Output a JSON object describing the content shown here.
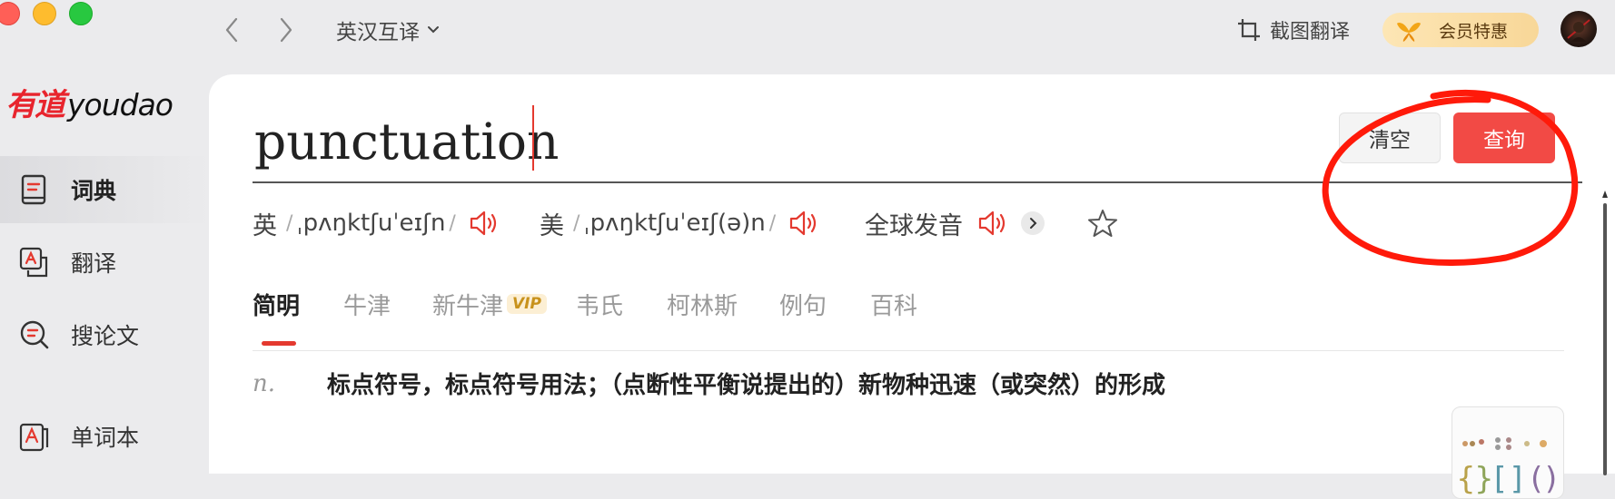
{
  "window": {
    "traffic_lights": [
      "close",
      "minimize",
      "zoom"
    ]
  },
  "topbar": {
    "mode_label": "英汉互译",
    "screenshot_label": "截图翻译",
    "vip_label": "会员特惠"
  },
  "sidebar": {
    "logo_cn": "有道",
    "logo_en": "youdao",
    "items": [
      {
        "label": "词典",
        "icon": "book-icon",
        "active": true
      },
      {
        "label": "翻译",
        "icon": "translate-icon",
        "active": false
      },
      {
        "label": "搜论文",
        "icon": "search-paper-icon",
        "active": false
      },
      {
        "label": "单词本",
        "icon": "wordbook-icon",
        "active": false
      }
    ]
  },
  "search": {
    "query": "punctuation",
    "clear_label": "清空",
    "search_label": "查询"
  },
  "pronunciation": {
    "uk_label": "英",
    "uk_ipa": "ˌpʌŋktʃuˈeɪʃn",
    "us_label": "美",
    "us_ipa": "ˌpʌŋktʃuˈeɪʃ(ə)n",
    "global_label": "全球发音"
  },
  "tabs": [
    {
      "label": "简明",
      "active": true
    },
    {
      "label": "牛津"
    },
    {
      "label": "新牛津",
      "badge": "VIP"
    },
    {
      "label": "韦氏"
    },
    {
      "label": "柯林斯"
    },
    {
      "label": "例句"
    },
    {
      "label": "百科"
    }
  ],
  "definition": {
    "pos": "n.",
    "text": "标点符号，标点符号用法；（点断性平衡说提出的）新物种迅速（或突然）的形成"
  },
  "colors": {
    "accent_red": "#f24a45",
    "annotation_red": "#ff1a0a",
    "vip_gold": "#c8921c"
  }
}
